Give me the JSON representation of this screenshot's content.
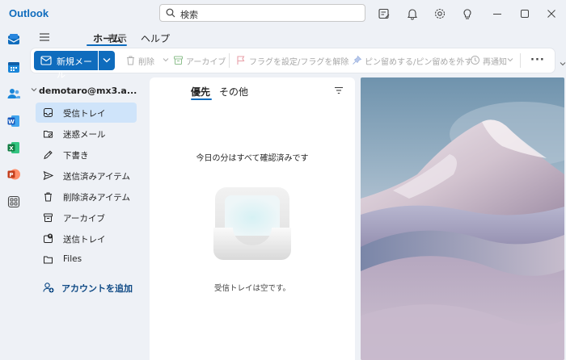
{
  "titlebar": {
    "app_name": "Outlook",
    "search_placeholder": "検索"
  },
  "ribbon_tabs": [
    {
      "label": "ホーム"
    },
    {
      "label": "表示"
    },
    {
      "label": "ヘルプ"
    }
  ],
  "ribbon": {
    "new_mail": "新規メール",
    "delete": "削除",
    "archive": "アーカイブ",
    "flag": "フラグを設定/フラグを解除",
    "pin": "ピン留めする/ピン留めを外す",
    "snooze": "再通知",
    "more": "···"
  },
  "folders": {
    "account": "demotaro@mx3.a...",
    "items": [
      {
        "label": "受信トレイ",
        "icon": "inbox-icon"
      },
      {
        "label": "迷惑メール",
        "icon": "junk-icon"
      },
      {
        "label": "下書き",
        "icon": "drafts-icon"
      },
      {
        "label": "送信済みアイテム",
        "icon": "send-icon"
      },
      {
        "label": "削除済みアイテム",
        "icon": "trash-icon"
      },
      {
        "label": "アーカイブ",
        "icon": "archive-icon"
      },
      {
        "label": "送信トレイ",
        "icon": "outbox-icon"
      },
      {
        "label": "Files",
        "icon": "folder-icon"
      }
    ],
    "add_account": "アカウントを追加"
  },
  "maillist": {
    "tabs": [
      {
        "label": "優先"
      },
      {
        "label": "その他"
      }
    ],
    "empty_title": "今日の分はすべて確認済みです",
    "empty_subtitle": "受信トレイは空です。"
  },
  "colors": {
    "accent": "#0f6cbd",
    "selected_bg": "#cfe4fa",
    "chrome_bg": "#eef1f6"
  }
}
